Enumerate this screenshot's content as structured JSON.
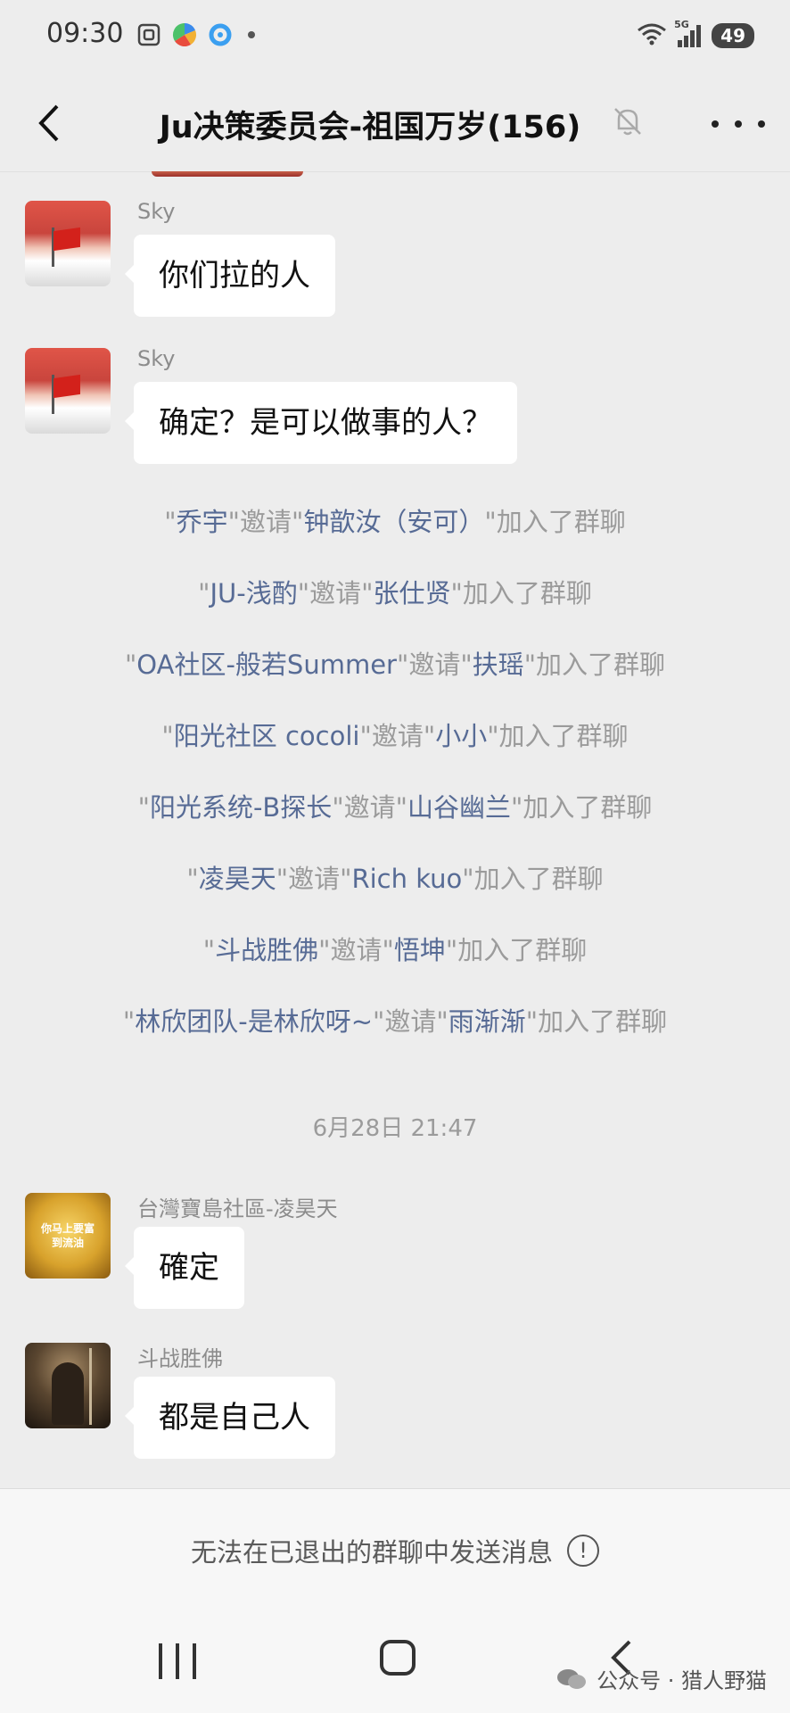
{
  "status_bar": {
    "time": "09:30",
    "network": "5G",
    "battery": "49"
  },
  "header": {
    "title": "Ju决策委员会-祖国万岁(156)"
  },
  "messages": [
    {
      "sender": "Sky",
      "text": "你们拉的人"
    },
    {
      "sender": "Sky",
      "text": "确定？是可以做事的人？"
    }
  ],
  "system_messages": [
    {
      "inviter": "乔宇",
      "verb": "邀请",
      "invitee": "钟歆汝（安可）",
      "tail": "加入了群聊"
    },
    {
      "inviter": "JU-浅酌",
      "verb": "邀请",
      "invitee": "张仕贤",
      "tail": "加入了群聊"
    },
    {
      "inviter": "OA社区-般若Summer",
      "verb": "邀请",
      "invitee": "扶瑶",
      "tail": "加入了群聊"
    },
    {
      "inviter": "阳光社区 cocoli",
      "verb": "邀请",
      "invitee": "小小",
      "tail": "加入了群聊"
    },
    {
      "inviter": "阳光系统-B探长",
      "verb": "邀请",
      "invitee": "山谷幽兰",
      "tail": "加入了群聊"
    },
    {
      "inviter": "凌昊天",
      "verb": "邀请",
      "invitee": "Rich kuo",
      "tail": "加入了群聊"
    },
    {
      "inviter": "斗战胜佛",
      "verb": "邀请",
      "invitee": "悟坤",
      "tail": "加入了群聊"
    },
    {
      "inviter": "林欣团队-是林欣呀~",
      "verb": "邀请",
      "invitee": "雨渐渐",
      "tail": "加入了群聊"
    }
  ],
  "timestamp": "6月28日 21:47",
  "messages_after": [
    {
      "sender": "台灣寶島社區-凌昊天",
      "text": "確定",
      "avatar_text": "你马上要富到流油"
    },
    {
      "sender": "斗战胜佛",
      "text": "都是自己人"
    }
  ],
  "footer": {
    "notice": "无法在已退出的群聊中发送消息"
  },
  "watermark": {
    "text": "公众号 · 猎人野猫"
  },
  "colors": {
    "background": "#ededed",
    "bubble": "#ffffff",
    "name_link": "#576b95",
    "system_text": "#9b9b9b"
  }
}
